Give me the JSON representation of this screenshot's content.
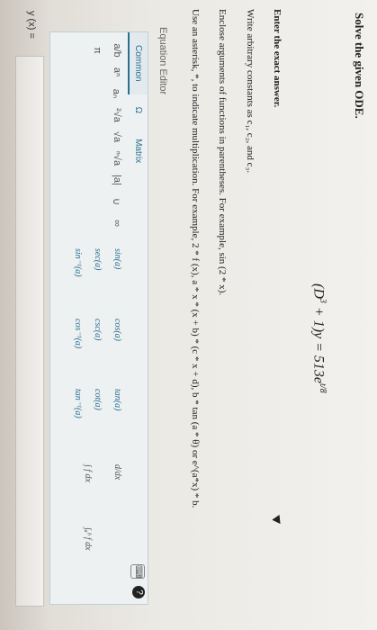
{
  "question": {
    "title": "Solve the given ODE.",
    "ode": {
      "lhs": "(D",
      "power": "3",
      "rest": " + 1)y = 513e",
      "exp": "t/8"
    },
    "instruction_exact": "Enter the exact answer.",
    "instruction_constants": "Write arbitrary constants as c₁, c₂, and c₃.",
    "instruction_parentheses": "Enclose arguments of functions in parentheses. For example, sin (2 * x).",
    "instruction_asterisk": "Use an asterisk, *, to indicate multiplication. For example, 2 * f (x), a * x * (x + b) * (c * x + d), b * tan (a * θ) or e^(a*x) * b."
  },
  "editor": {
    "label": "Equation Editor",
    "tabs": [
      "Common",
      "Ω",
      "Matrix"
    ],
    "help_icon": "?",
    "palette": [
      "a/b",
      "aⁿ",
      "aₙ",
      "²√a",
      "√a",
      "ⁿ√a",
      "|a|",
      "∪",
      "∞",
      "π",
      "",
      ""
    ],
    "functions": [
      "sin(a)",
      "cos(a)",
      "tan(a)",
      "sec(a)",
      "csc(a)",
      "cot(a)",
      "sin⁻¹(a)",
      "cos⁻¹(a)",
      "tan⁻¹(a)"
    ],
    "calculus": [
      "d/dx",
      "∫ f dx",
      "∫ₐᵇ f dx"
    ]
  },
  "answer": {
    "label": "y (x) =",
    "value": ""
  }
}
